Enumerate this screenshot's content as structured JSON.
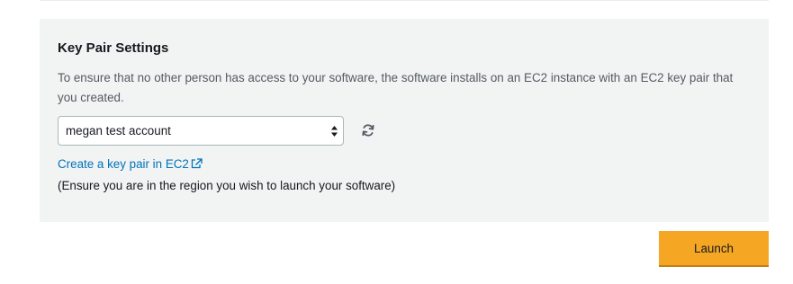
{
  "key_pair_settings": {
    "title": "Key Pair Settings",
    "description": "To ensure that no other person has access to your software, the software installs on an EC2 instance with an EC2 key pair that you created.",
    "select": {
      "selected_value": "megan test account"
    },
    "create_link_label": "Create a key pair in EC2",
    "region_note": "(Ensure you are in the region you wish to launch your software)"
  },
  "actions": {
    "launch_label": "Launch"
  },
  "icons": {
    "refresh": "refresh-icon",
    "external_link": "external-link-icon",
    "select_arrows": "select-arrows-icon"
  },
  "colors": {
    "panel_background": "#f2f3f3",
    "link": "#0073bb",
    "launch_button": "#f5a623"
  }
}
